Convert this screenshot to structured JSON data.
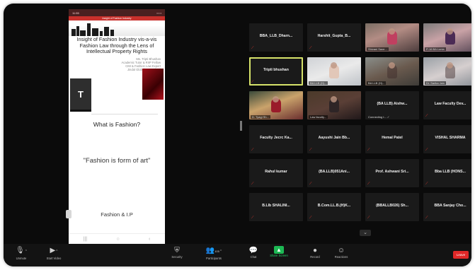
{
  "shared_screen": {
    "status_time": "11:55",
    "banner_text": "Insight of Fashion Industry",
    "slide_title": "Insight of Fashion Industry vis-a-vis Fashion Law through the Lens of Intellectual Property Rights",
    "presenter": "Ms. Tripti Bhushan\nAcademic Tutor & RIIP Fellow\nCIM & Fashion Law Expert\nJindal Global Law School",
    "book_letter": "T",
    "question": "What is Fashion?",
    "quote": "\"Fashion is form of art\"",
    "footer_text": "Fashion & I.P",
    "nav_back": "‹",
    "nav_home": "○",
    "nav_recent": "|||"
  },
  "participants": [
    {
      "name": "BBA_LLB_Dharn...",
      "type": "name"
    },
    {
      "name": "Harshit_Gupta_B...",
      "type": "name"
    },
    {
      "name": "Shivani Saxe...",
      "type": "video",
      "v": "v1"
    },
    {
      "name": "P-16 BA Lonia",
      "type": "video",
      "v": "v2"
    },
    {
      "name": "Tripti bhushan",
      "type": "name",
      "active": true
    },
    {
      "name": "BA LLB (H)...",
      "type": "video",
      "v": "v3"
    },
    {
      "name": "BA LLB (H)...",
      "type": "video",
      "v": "v4"
    },
    {
      "name": "Dr. Sarika Jain",
      "type": "video",
      "v": "v5"
    },
    {
      "name": "D. Tyagi Sh...",
      "type": "video",
      "v": "v6"
    },
    {
      "name": "Law faculty...",
      "type": "video",
      "v": "v7"
    },
    {
      "name": "(BA LLB) Aishw...",
      "type": "name",
      "sub": "Connecting t... ✓"
    },
    {
      "name": "Law Faculty Dev...",
      "type": "name"
    },
    {
      "name": "Faculty Jecrc Ka...",
      "type": "name"
    },
    {
      "name": "Aayushi Jain Bb...",
      "type": "name"
    },
    {
      "name": "Hemal Patel",
      "type": "name"
    },
    {
      "name": "VISHAL SHARMA",
      "type": "name"
    },
    {
      "name": "Rahul kumar",
      "type": "name"
    },
    {
      "name": "(BA.LLB)051Ani...",
      "type": "name"
    },
    {
      "name": "Prof. Ashwani Sri...",
      "type": "name"
    },
    {
      "name": "Bba LLB (HONS...",
      "type": "name"
    },
    {
      "name": "B.Llb SHALINI...",
      "type": "name"
    },
    {
      "name": "B.Com.LL.B.(H)K...",
      "type": "name"
    },
    {
      "name": "(BBALLB026) Sh...",
      "type": "name"
    },
    {
      "name": "BBA Sanjay Cho...",
      "type": "name"
    }
  ],
  "toolbar": {
    "unmute": "Unmute",
    "start_video": "Start Video",
    "security": "Security",
    "participants": "Participants",
    "participants_count": "105",
    "chat": "Chat",
    "share_screen": "Share Screen",
    "record": "Record",
    "reactions": "Reactions",
    "leave": "Leave"
  },
  "icons": {
    "mic": "mic-muted-icon",
    "video": "video-off-icon",
    "security": "shield-icon",
    "participants": "people-icon",
    "chat": "chat-icon",
    "share": "share-screen-icon",
    "record": "record-icon",
    "reactions": "emoji-icon"
  },
  "colors": {
    "leave": "#e02828",
    "share": "#1db954",
    "active_speaker": "#d7e36a",
    "muted": "#ff3b30"
  }
}
